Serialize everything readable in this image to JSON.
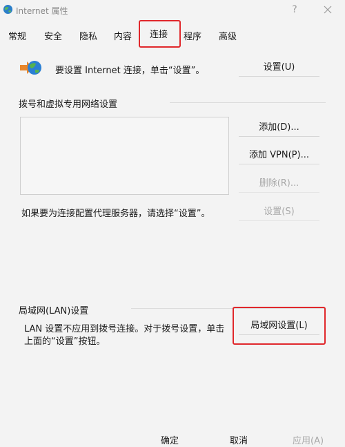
{
  "window": {
    "title": "Internet 属性",
    "help_label": "?"
  },
  "tabs": [
    {
      "label": "常规"
    },
    {
      "label": "安全"
    },
    {
      "label": "隐私"
    },
    {
      "label": "内容"
    },
    {
      "label": "连接"
    },
    {
      "label": "程序"
    },
    {
      "label": "高级"
    }
  ],
  "setup": {
    "text": "要设置 Internet 连接，单击“设置”。",
    "button_label": "设置(U)"
  },
  "dialup": {
    "heading": "拨号和虚拟专用网络设置",
    "add_label": "添加(D)...",
    "add_vpn_label": "添加 VPN(P)...",
    "remove_label": "删除(R)...",
    "proxy_text": "如果要为连接配置代理服务器，请选择“设置”。",
    "settings_label": "设置(S)"
  },
  "lan": {
    "heading": "局域网(LAN)设置",
    "desc_line1": "LAN 设置不应用到拨号连接。对于拨号设置，单击",
    "desc_line2": "上面的“设置”按钮。",
    "button_label": "局域网设置(L)"
  },
  "footer": {
    "ok_label": "确定",
    "cancel_label": "取消",
    "apply_label": "应用(A)"
  },
  "colors": {
    "highlight": "#e0272b",
    "disabled_text": "#a8a8a8"
  }
}
